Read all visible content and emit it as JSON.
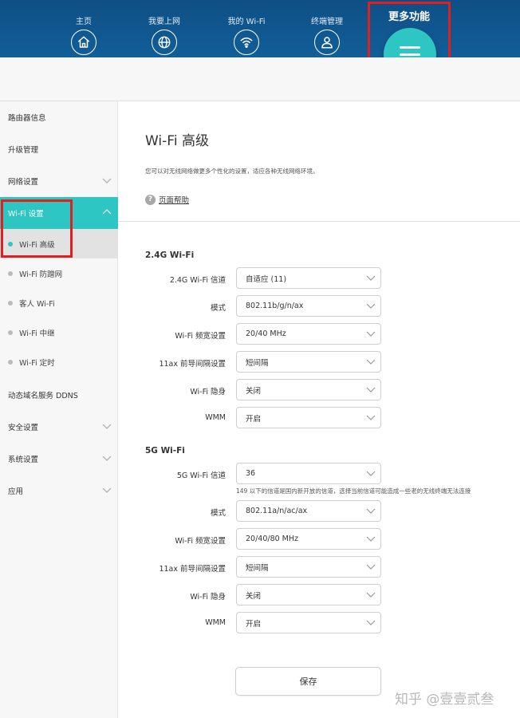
{
  "nav": {
    "items": [
      {
        "label": "主页",
        "icon": "home-icon"
      },
      {
        "label": "我要上网",
        "icon": "globe-icon"
      },
      {
        "label": "我的 Wi-Fi",
        "icon": "wifi-icon"
      },
      {
        "label": "终端管理",
        "icon": "user-icon"
      }
    ],
    "more_label": "更多功能",
    "more_icon": "menu-icon"
  },
  "sidebar": {
    "items": [
      {
        "label": "路由器信息"
      },
      {
        "label": "升级管理"
      },
      {
        "label": "网络设置"
      },
      {
        "label": "Wi-Fi 设置"
      },
      {
        "label": "动态域名服务 DDNS"
      },
      {
        "label": "安全设置"
      },
      {
        "label": "系统设置"
      },
      {
        "label": "应用"
      }
    ],
    "subitems": [
      {
        "label": "Wi-Fi 高级"
      },
      {
        "label": "Wi-Fi 防蹭网"
      },
      {
        "label": "客人 Wi-Fi"
      },
      {
        "label": "Wi-Fi 中继"
      },
      {
        "label": "Wi-Fi 定时"
      }
    ]
  },
  "main": {
    "title": "Wi-Fi 高级",
    "description": "您可以对无线网络做更多个性化的设置，适应各种无线网络环境。",
    "help": "页面帮助",
    "section_24g": {
      "title": "2.4G Wi-Fi",
      "rows": [
        {
          "label": "2.4G Wi-Fi 信道",
          "value": "自适应 (11)"
        },
        {
          "label": "模式",
          "value": "802.11b/g/n/ax"
        },
        {
          "label": "Wi-Fi 频宽设置",
          "value": "20/40 MHz"
        },
        {
          "label": "11ax 前导间隔设置",
          "value": "短间隔"
        },
        {
          "label": "Wi-Fi 隐身",
          "value": "关闭"
        },
        {
          "label": "WMM",
          "value": "开启"
        }
      ]
    },
    "section_5g": {
      "title": "5G Wi-Fi",
      "rows": [
        {
          "label": "5G Wi-Fi 信道",
          "value": "36"
        },
        {
          "label": "模式",
          "value": "802.11a/n/ac/ax"
        },
        {
          "label": "Wi-Fi 频宽设置",
          "value": "20/40/80 MHz"
        },
        {
          "label": "11ax 前导间隔设置",
          "value": "短间隔"
        },
        {
          "label": "Wi-Fi 隐身",
          "value": "关闭"
        },
        {
          "label": "WMM",
          "value": "开启"
        }
      ],
      "channel_note": "149 以下的信道是国内新开放的信道，选择当前信道可能造成一些老的无线终端无法连接"
    },
    "save_label": "保存"
  },
  "watermark": "知乎 @壹壹贰叁",
  "colors": {
    "nav_bg": "#125e98",
    "accent": "#2ec6c3",
    "highlight_border": "#e02020"
  }
}
